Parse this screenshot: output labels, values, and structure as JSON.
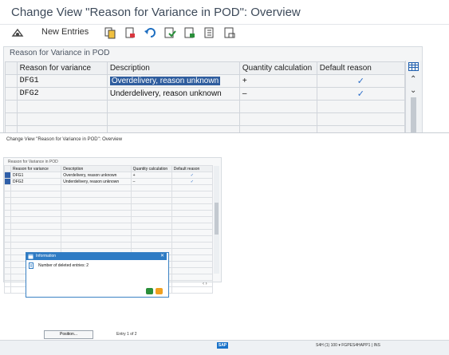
{
  "top": {
    "title": "Change View \"Reason for Variance in POD\": Overview",
    "toolbar": {
      "new_entries": "New Entries"
    },
    "panel_caption": "Reason for Variance in POD",
    "columns": [
      "Reason for variance",
      "Description",
      "Quantity calculation",
      "Default reason"
    ],
    "rows": [
      {
        "reason": "DFG1",
        "description": "Overdelivery, reason unknown",
        "qty": "+",
        "default": "✓"
      },
      {
        "reason": "DFG2",
        "description": "Underdelivery, reason unknown",
        "qty": "–",
        "default": "✓"
      }
    ]
  },
  "second": {
    "title": "Change View \"Reason for Variance in POD\": Overview",
    "panel_caption": "Reason for Variance in POD",
    "columns": [
      "Reason for variance",
      "Description",
      "Quantity calculation",
      "Default reason"
    ],
    "rows": [
      {
        "reason": "DFG1",
        "description": "Overdelivery, reason unknown",
        "qty": "+",
        "default": "✓"
      },
      {
        "reason": "DFG2",
        "description": "Underdelivery, reason unknown",
        "qty": "–",
        "default": "✓"
      }
    ],
    "dialog": {
      "title": "Information",
      "message": "Number of deleted entries: 2"
    },
    "position_button": "Position...",
    "entry_text": "Entry 1 of 2",
    "status_text": "S4H (1) 100  ▾  FGPES4HAPP1 | INS"
  },
  "colors": {
    "accent": "#2e7bc4",
    "selection": "#2f5d9e"
  }
}
